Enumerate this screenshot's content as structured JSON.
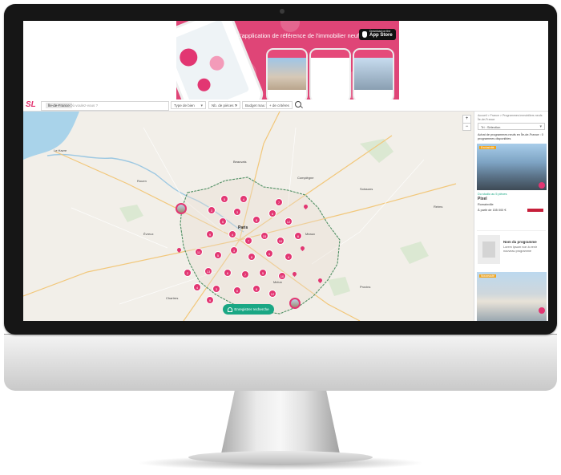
{
  "banner": {
    "headline": "L'application de référence de l'immobilier neuf",
    "store_small": "Download on the",
    "store_big": "App Store"
  },
  "search": {
    "logo": "SL",
    "location_chip": "Île-de-France",
    "placeholder": "Où voulez-vous ?",
    "type_filter": "Type de bien",
    "rooms_filter": "Nb. de pièces ?",
    "budget_filter": "Budget max.",
    "criteria_filter": "+ de critères"
  },
  "map": {
    "save_button": "Enregistrer recherche",
    "zoom_in": "+",
    "zoom_out": "−",
    "labels": [
      "Le Havre",
      "Rouen",
      "Beauvais",
      "Compiègne",
      "Soissons",
      "Reims",
      "Paris",
      "Évreux",
      "Meaux",
      "Chartres",
      "Provins",
      "Melun"
    ],
    "clusters": [
      "3",
      "5",
      "8",
      "6",
      "12",
      "9",
      "4",
      "7",
      "15",
      "10",
      "6",
      "11",
      "5",
      "3",
      "8",
      "9",
      "4",
      "2",
      "13",
      "6",
      "7",
      "5",
      "10",
      "4",
      "3",
      "6",
      "8",
      "12",
      "5",
      "9",
      "4",
      "7",
      "3"
    ]
  },
  "sidebar": {
    "breadcrumb": "Accueil > France > Programmes immobiliers neufs Île-de-France",
    "sort_label": "Tri : Sélection",
    "results": "Achat de programmes neufs en Île-de-France : 0 programmes disponibles",
    "card1_tag": "Exclusivité",
    "card1_subtitle": "Du studio au 5 pièces",
    "card1_title": "Pixel",
    "card1_city": "Romainville",
    "card1_price": "À partir de 155 000 €",
    "card2_title": "Nom du programme",
    "card2_desc": "Lorem Ipsum non à venir",
    "card2_desc2": "nouveau programme",
    "card3_tag": "Nouveauté"
  }
}
